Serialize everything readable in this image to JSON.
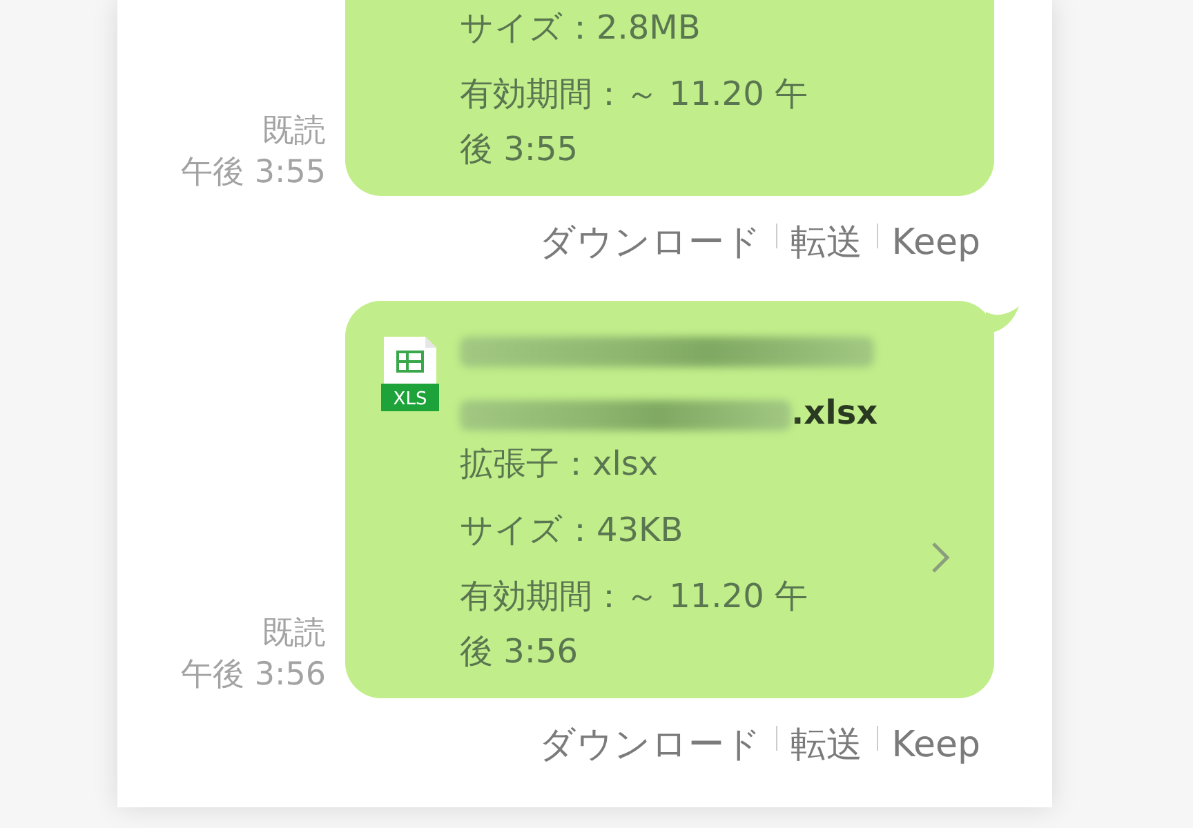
{
  "messages": [
    {
      "tail": false,
      "fields": [
        "サイズ：2.8MB",
        "有効期間：～ 11.20 午後 3:55"
      ],
      "detail_arrow": false,
      "read": "既読",
      "time": "午後 3:55",
      "actions": [
        "ダウンロード",
        "転送",
        "Keep"
      ]
    },
    {
      "tail": true,
      "file": {
        "icon_label": "XLS",
        "name_suffix": ".xlsx"
      },
      "fields": [
        "拡張子：xlsx",
        "サイズ：43KB",
        "有効期間：～ 11.20 午後 3:56"
      ],
      "detail_arrow": true,
      "read": "既読",
      "time": "午後 3:56",
      "actions": [
        "ダウンロード",
        "転送",
        "Keep"
      ]
    }
  ]
}
